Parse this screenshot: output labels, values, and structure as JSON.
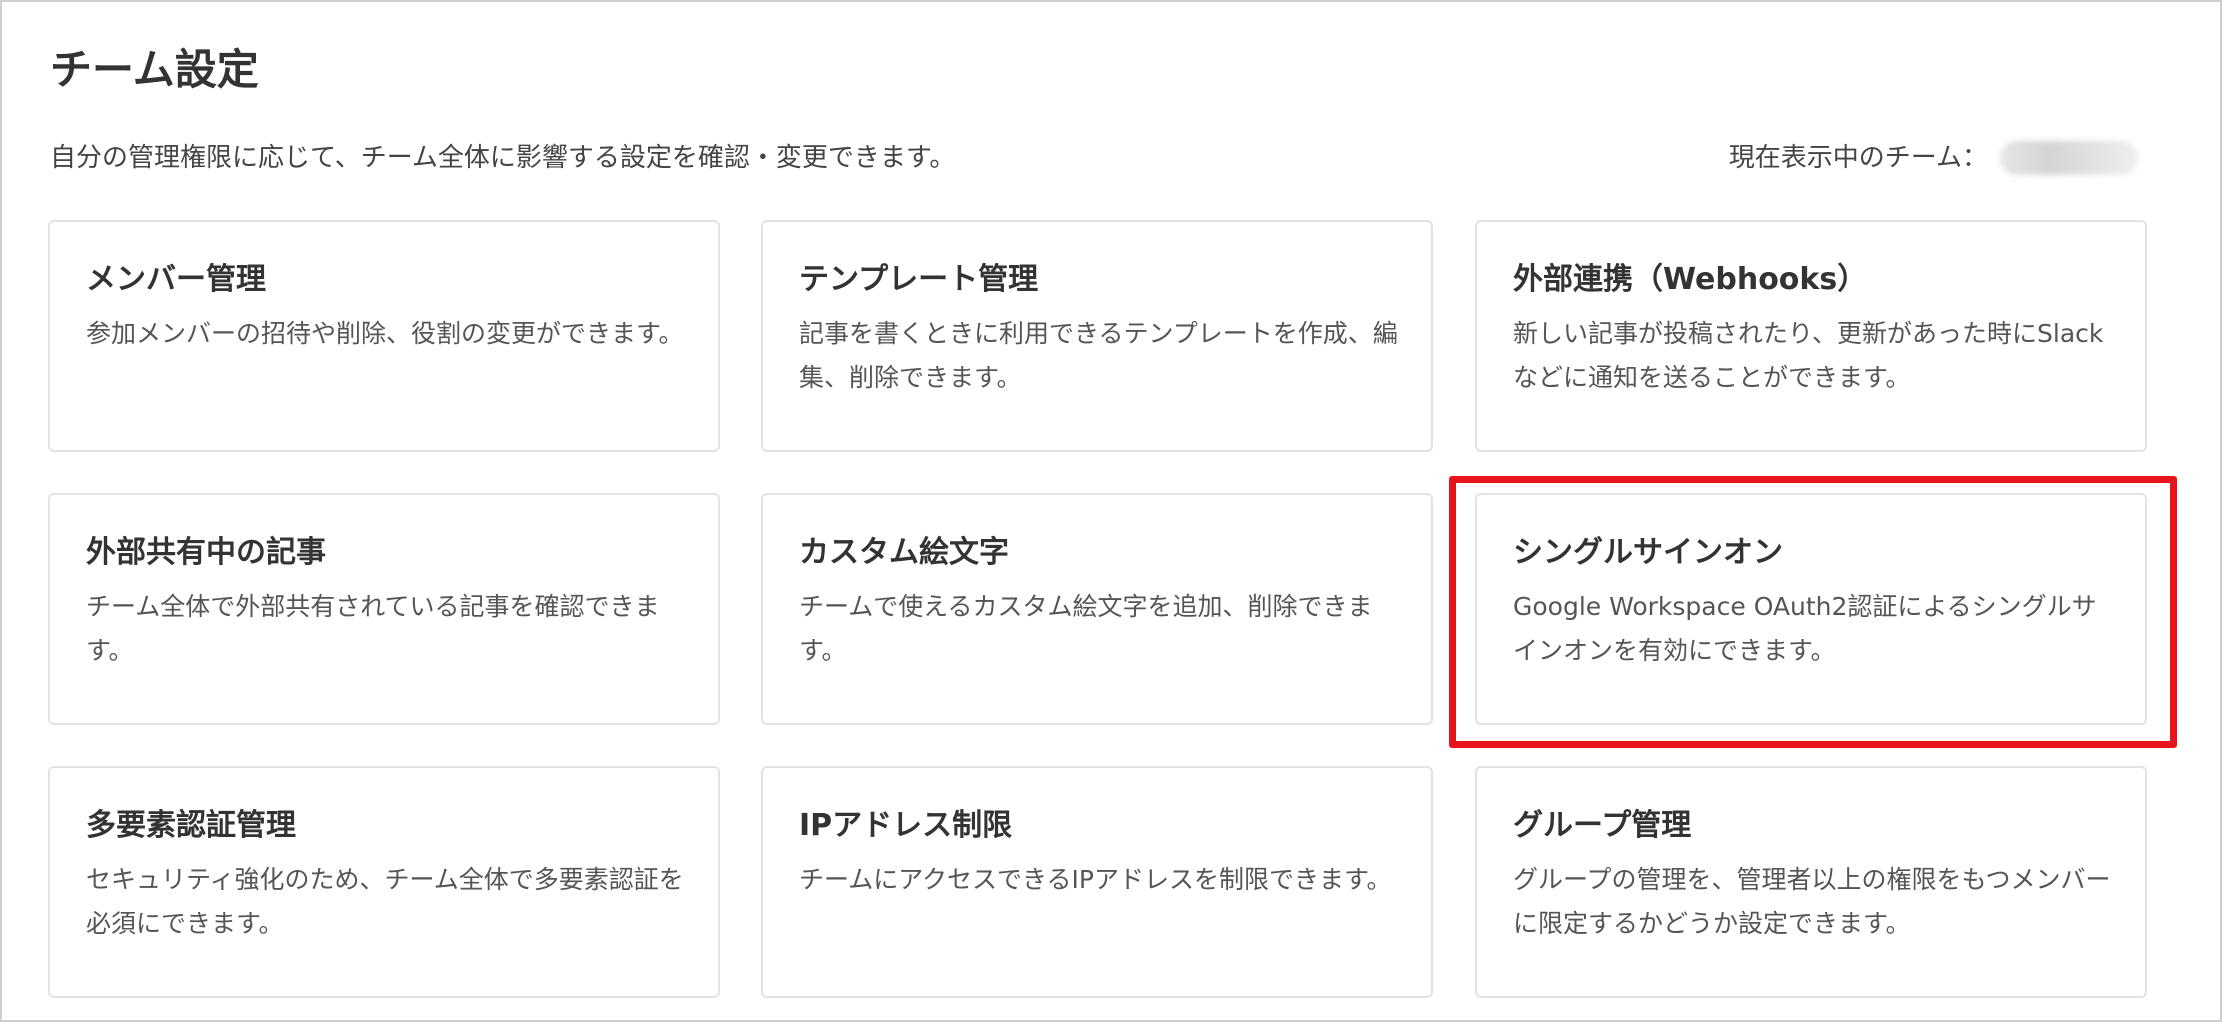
{
  "page": {
    "title": "チーム設定",
    "description": "自分の管理権限に応じて、チーム全体に影響する設定を確認・変更できます。",
    "current_team_label": "現在表示中のチーム："
  },
  "cards": [
    {
      "title": "メンバー管理",
      "description": "参加メンバーの招待や削除、役割の変更ができます。"
    },
    {
      "title": "テンプレート管理",
      "description": "記事を書くときに利用できるテンプレートを作成、編集、削除できます。"
    },
    {
      "title": "外部連携（Webhooks）",
      "description": "新しい記事が投稿されたり、更新があった時にSlackなどに通知を送ることができます。"
    },
    {
      "title": "外部共有中の記事",
      "description": "チーム全体で外部共有されている記事を確認できます。"
    },
    {
      "title": "カスタム絵文字",
      "description": "チームで使えるカスタム絵文字を追加、削除できます。"
    },
    {
      "title": "シングルサインオン",
      "description": "Google Workspace OAuth2認証によるシングルサインオンを有効にできます。"
    },
    {
      "title": "多要素認証管理",
      "description": "セキュリティ強化のため、チーム全体で多要素認証を必須にできます。"
    },
    {
      "title": "IPアドレス制限",
      "description": "チームにアクセスできるIPアドレスを制限できます。"
    },
    {
      "title": "グループ管理",
      "description": "グループの管理を、管理者以上の権限をもつメンバーに限定するかどうか設定できます。"
    }
  ],
  "colors": {
    "highlight": "#e8141b",
    "card_border": "#e2e2e2"
  }
}
